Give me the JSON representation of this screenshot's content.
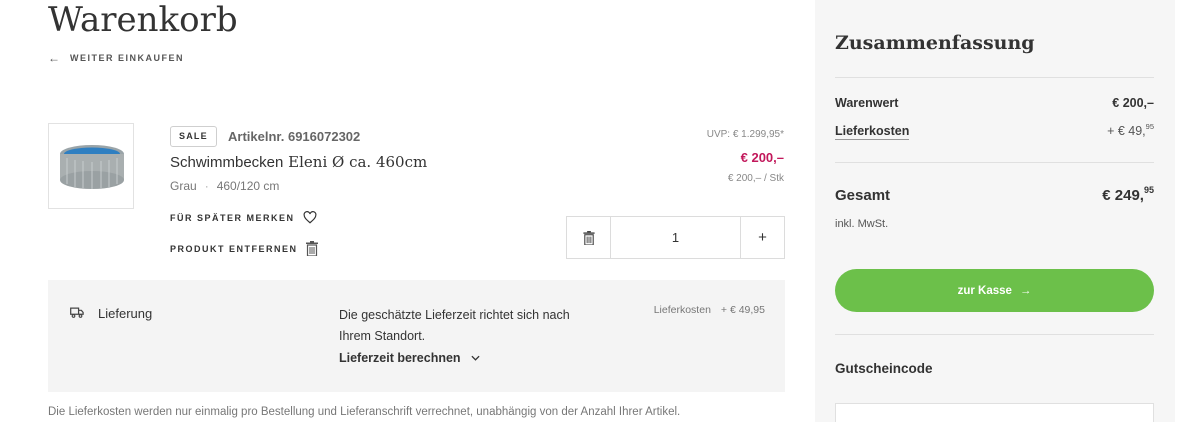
{
  "page": {
    "title": "Warenkorb",
    "back_label": "WEITER EINKAUFEN"
  },
  "item": {
    "badge": "SALE",
    "article_number": "Artikelnr. 6916072302",
    "name_bold": "Schwimmbecken",
    "name_rest": "Eleni Ø ca. 460cm",
    "color": "Grau",
    "size": "460/120 cm",
    "uvp": "UVP: € 1.299,95*",
    "price": "€ 200,–",
    "unit_price": "€ 200,– / Stk",
    "save_label": "FÜR SPÄTER MERKEN",
    "remove_label": "PRODUKT ENTFERNEN",
    "quantity": "1",
    "plus_label": "+"
  },
  "delivery": {
    "label": "Lieferung",
    "info": "Die geschätzte Lieferzeit richtet sich nach Ihrem Standort.",
    "calc_label": "Lieferzeit berechnen",
    "cost_label": "Lieferkosten",
    "cost_value": "+ € 49,95"
  },
  "footnote": "Die Lieferkosten werden nur einmalig pro Bestellung und Lieferanschrift verrechnet, unabhängig von der Anzahl Ihrer Artikel.",
  "summary": {
    "title": "Zusammenfassung",
    "goods_label": "Warenwert",
    "goods_value": "€ 200,–",
    "shipping_label": "Lieferkosten",
    "shipping_value": "+ € 49,",
    "shipping_cents": "95",
    "total_label": "Gesamt",
    "total_value": "€ 249,",
    "total_cents": "95",
    "vat_note": "inkl. MwSt.",
    "checkout_label": "zur Kasse",
    "coupon_label": "Gutscheincode"
  },
  "colors": {
    "accent_green": "#6cc04a",
    "sale_price": "#c2185b"
  },
  "icons": {
    "back": "arrow-left-icon",
    "save": "heart-icon",
    "remove": "trash-icon",
    "truck": "truck-icon",
    "chevron": "chevron-down-icon",
    "checkout": "arrow-right-icon"
  }
}
